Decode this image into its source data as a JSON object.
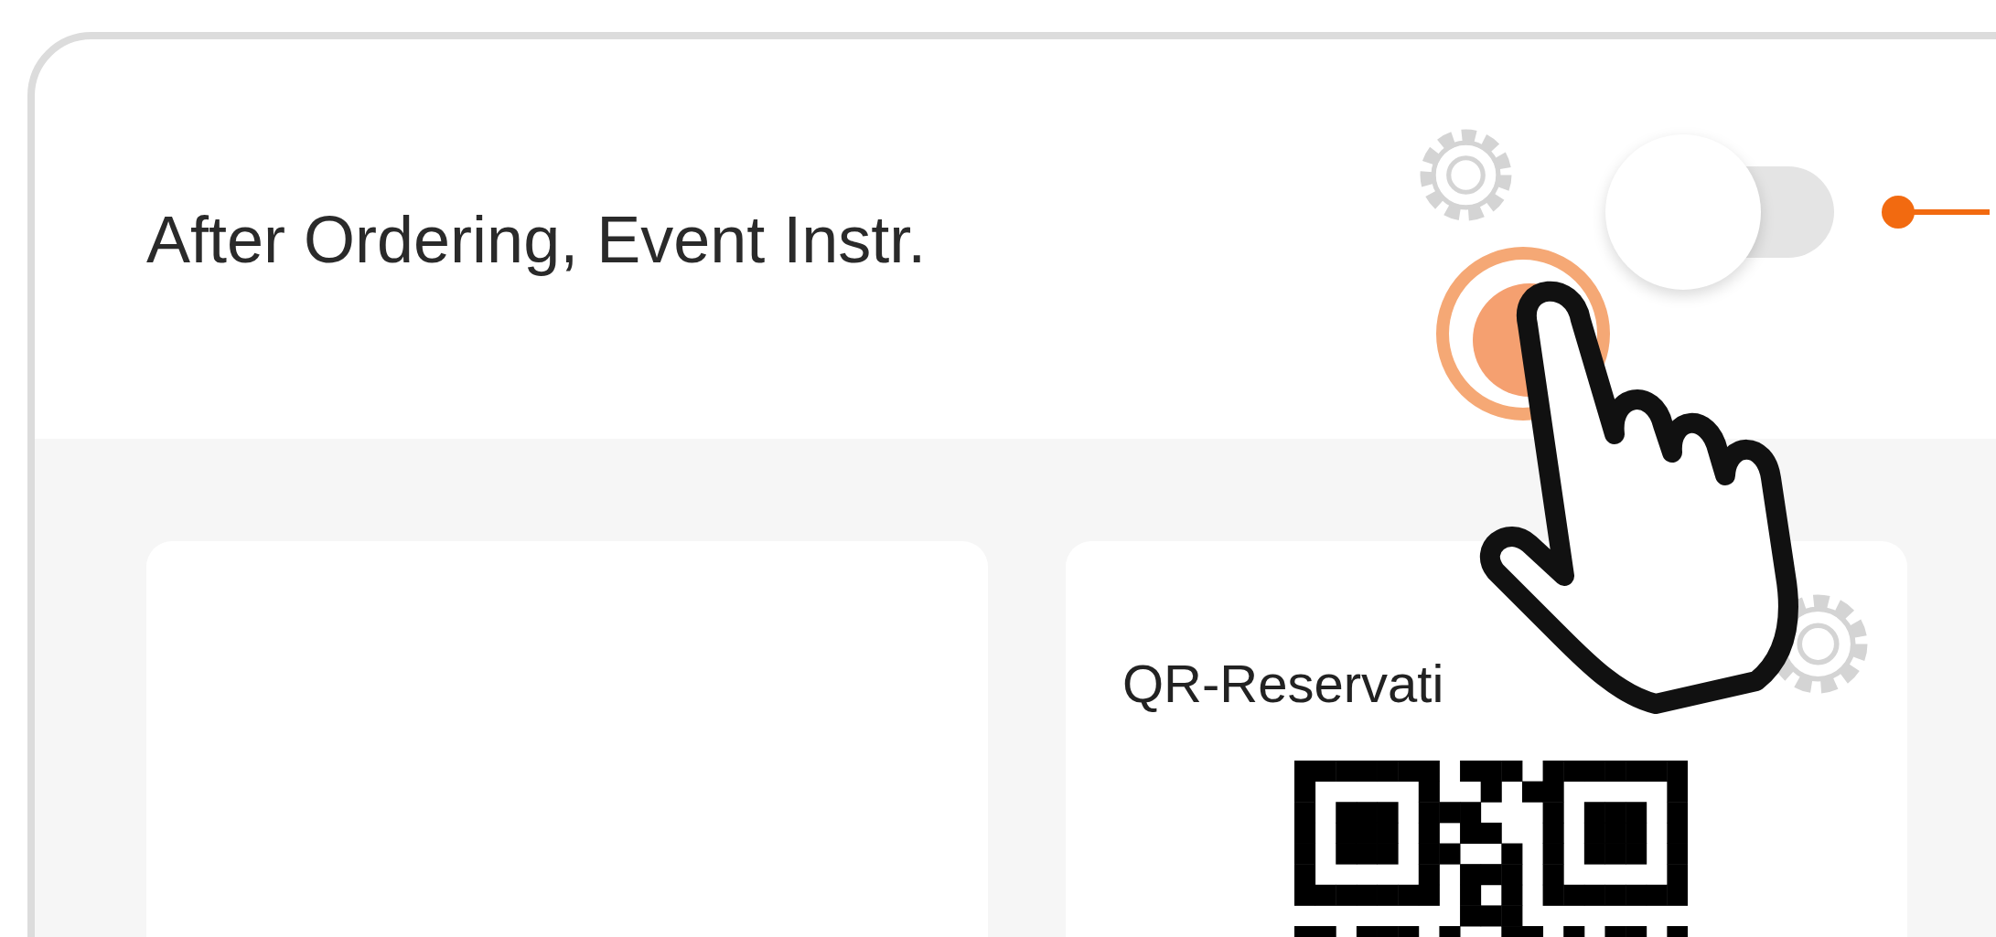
{
  "section": {
    "title": "After Ordering, Event Instr.",
    "toggle": {
      "on": false
    }
  },
  "cards": [
    {
      "kind": "blank"
    },
    {
      "kind": "qr",
      "title": "QR-Reservati"
    }
  ]
}
